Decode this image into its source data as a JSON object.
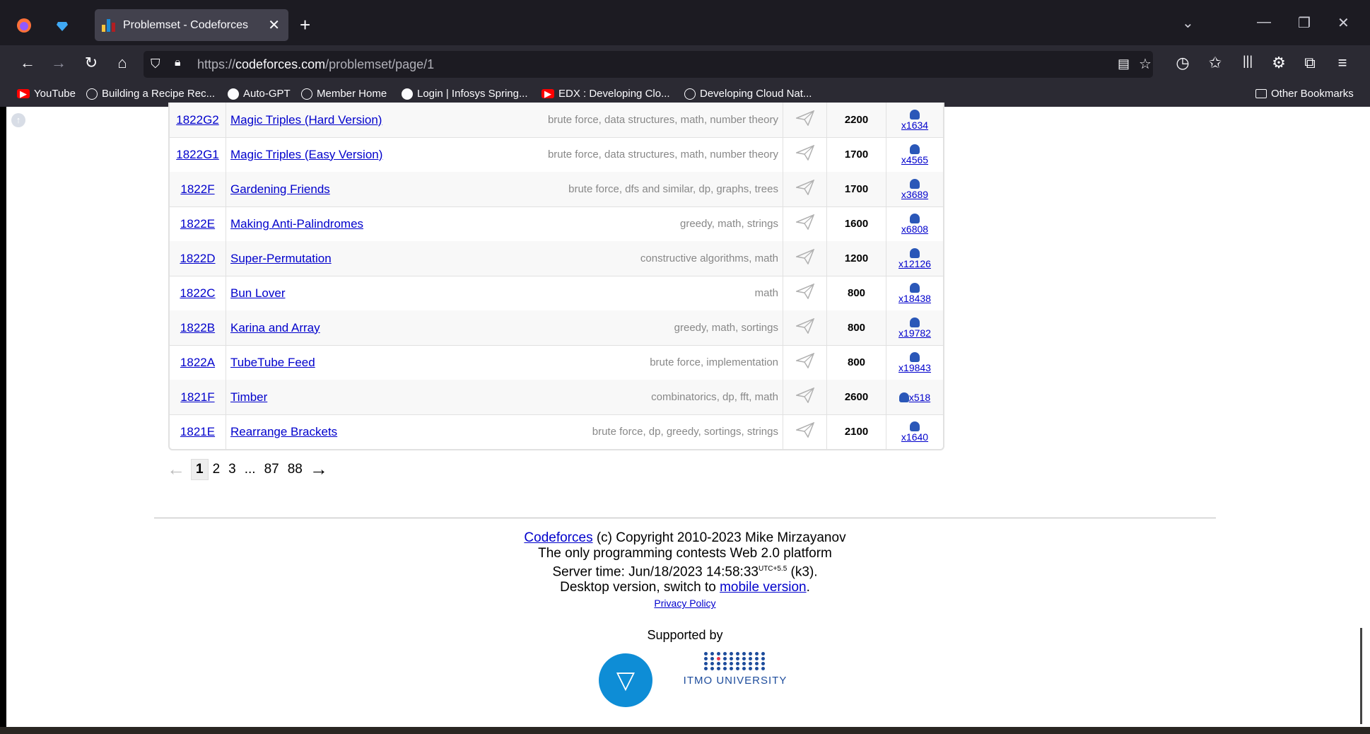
{
  "browser": {
    "tab_title": "Problemset - Codeforces",
    "url_prefix": "https://",
    "url_domain": "codeforces.com",
    "url_path": "/problemset/page/1",
    "bookmarks": [
      {
        "label": "YouTube",
        "icon": "youtube-icon"
      },
      {
        "label": "Building a Recipe Rec...",
        "icon": "globe-icon"
      },
      {
        "label": "Auto-GPT",
        "icon": "github-icon"
      },
      {
        "label": "Member Home",
        "icon": "globe-icon"
      },
      {
        "label": "Login | Infosys Spring...",
        "icon": "infosys-icon"
      },
      {
        "label": "EDX : Developing Clo...",
        "icon": "youtube-icon"
      },
      {
        "label": "Developing Cloud Nat...",
        "icon": "globe-icon"
      }
    ],
    "other_bookmarks": "Other Bookmarks"
  },
  "problems": [
    {
      "id": "1822G2",
      "name": "Magic Triples (Hard Version)",
      "tags": [
        "brute force",
        "data structures",
        "math",
        "number theory"
      ],
      "rating": "2200",
      "solved": "x1634"
    },
    {
      "id": "1822G1",
      "name": "Magic Triples (Easy Version)",
      "tags": [
        "brute force",
        "data structures",
        "math",
        "number theory"
      ],
      "rating": "1700",
      "solved": "x4565"
    },
    {
      "id": "1822F",
      "name": "Gardening Friends",
      "tags": [
        "brute force",
        "dfs and similar",
        "dp",
        "graphs",
        "trees"
      ],
      "rating": "1700",
      "solved": "x3689"
    },
    {
      "id": "1822E",
      "name": "Making Anti-Palindromes",
      "tags": [
        "greedy",
        "math",
        "strings"
      ],
      "rating": "1600",
      "solved": "x6808"
    },
    {
      "id": "1822D",
      "name": "Super-Permutation",
      "tags": [
        "constructive algorithms",
        "math"
      ],
      "rating": "1200",
      "solved": "x12126"
    },
    {
      "id": "1822C",
      "name": "Bun Lover",
      "tags": [
        "math"
      ],
      "rating": "800",
      "solved": "x18438"
    },
    {
      "id": "1822B",
      "name": "Karina and Array",
      "tags": [
        "greedy",
        "math",
        "sortings"
      ],
      "rating": "800",
      "solved": "x19782"
    },
    {
      "id": "1822A",
      "name": "TubeTube Feed",
      "tags": [
        "brute force",
        "implementation"
      ],
      "rating": "800",
      "solved": "x19843"
    },
    {
      "id": "1821F",
      "name": "Timber",
      "tags": [
        "combinatorics",
        "dp",
        "fft",
        "math"
      ],
      "rating": "2600",
      "solved": "x518"
    },
    {
      "id": "1821E",
      "name": "Rearrange Brackets",
      "tags": [
        "brute force",
        "dp",
        "greedy",
        "sortings",
        "strings"
      ],
      "rating": "2100",
      "solved": "x1640"
    }
  ],
  "pagination": {
    "prev": "←",
    "pages": [
      "1",
      "2",
      "3",
      "...",
      "87",
      "88"
    ],
    "active": "1",
    "next": "→"
  },
  "footer": {
    "codeforces_link": "Codeforces",
    "copyright": " (c) Copyright 2010-2023 Mike Mirzayanov",
    "tagline": "The only programming contests Web 2.0 platform",
    "server_time_label": "Server time: Jun/18/2023 14:58:33",
    "utc": "UTC+5.5",
    "server_suffix": " (k3).",
    "desktop_prefix": "Desktop version, switch to ",
    "mobile_link": "mobile version",
    "desktop_suffix": ".",
    "privacy": "Privacy Policy",
    "supported_by": "Supported by",
    "itmo": "ITMO UNIVERSITY"
  }
}
